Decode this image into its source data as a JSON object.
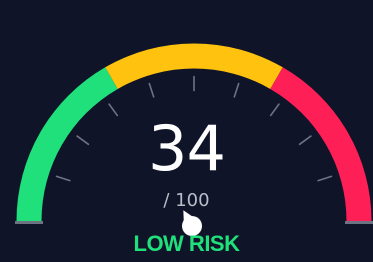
{
  "gauge": {
    "score": "34",
    "max_label": "/ 100",
    "value_fraction": 0.34,
    "risk_label": "LOW RISK",
    "colors": {
      "background": "#0f1428",
      "low": "#1fe07a",
      "medium": "#ffc20e",
      "high": "#ff1f57",
      "tick": "#6e7384",
      "needle": "#ffffff",
      "label": "#1fe07a"
    },
    "segments": [
      {
        "name": "low",
        "from": 0,
        "to": 0.3333
      },
      {
        "name": "medium",
        "from": 0.3333,
        "to": 0.6667
      },
      {
        "name": "high",
        "from": 0.6667,
        "to": 1
      }
    ]
  }
}
